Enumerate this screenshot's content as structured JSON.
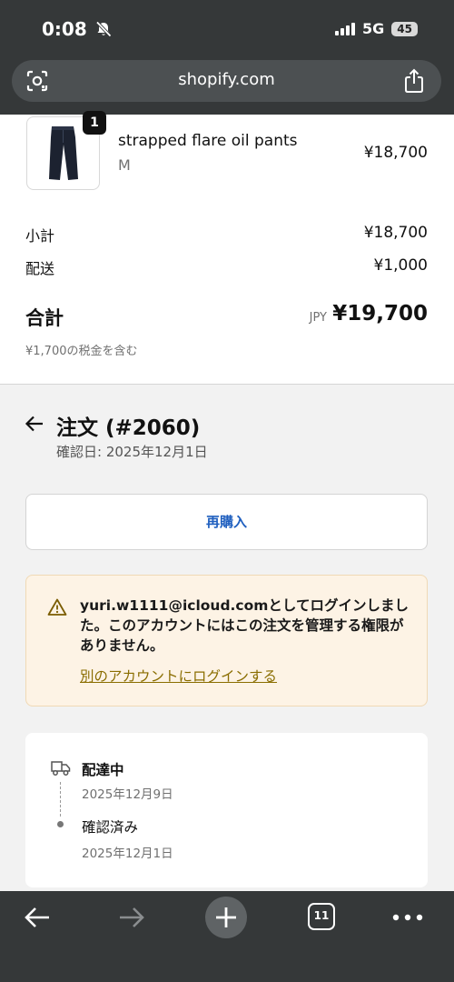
{
  "status_bar": {
    "time": "0:08",
    "network": "5G",
    "battery": "45"
  },
  "browser": {
    "url": "shopify.com",
    "tab_count": "11"
  },
  "product": {
    "quantity": "1",
    "name": "strapped flare oil pants",
    "variant": "M",
    "price": "¥18,700"
  },
  "summary": {
    "subtotal_label": "小計",
    "subtotal_value": "¥18,700",
    "shipping_label": "配送",
    "shipping_value": "¥1,000",
    "total_label": "合計",
    "currency": "JPY",
    "total_value": "¥19,700",
    "tax_note": "¥1,700の税金を含む"
  },
  "order": {
    "title": "注文 (#2060)",
    "confirmed_date": "確認日: 2025年12月1日"
  },
  "buy_again_label": "再購入",
  "warning": {
    "message": "yuri.w1111@icloud.comとしてログインしました。このアカウントにはこの注文を管理する権限がありません。",
    "link": "別のアカウントにログインする"
  },
  "timeline": {
    "items": [
      {
        "title": "配達中",
        "date": "2025年12月9日"
      },
      {
        "title": "確認済み",
        "date": "2025年12月1日"
      }
    ]
  }
}
